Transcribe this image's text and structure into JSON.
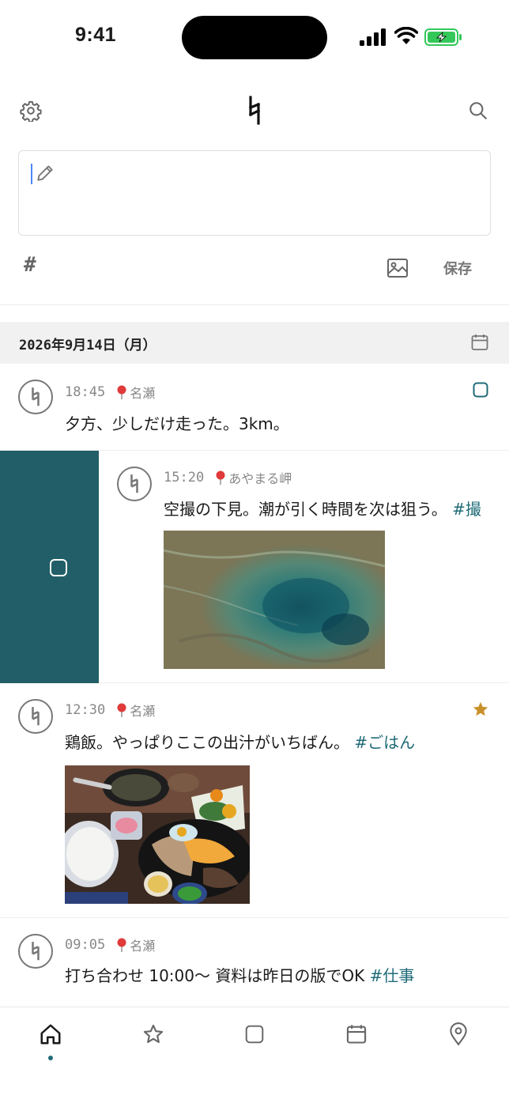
{
  "status_bar": {
    "time": "9:41"
  },
  "composer": {
    "value": "",
    "placeholder": "",
    "tag_label": "#",
    "save_label": "保存"
  },
  "date_header": {
    "label": "2026年9月14日（月）"
  },
  "entries": [
    {
      "time": "18:45",
      "location": "名瀬",
      "text": "夕方、少しだけ走った。3km。",
      "tag": "",
      "action": "square-icon"
    },
    {
      "time": "15:20",
      "location": "あやまる岬",
      "text": "空撮の下見。潮が引く時間を次は狙う。",
      "tag": "#撮",
      "image": "aerial-reef-photo"
    },
    {
      "time": "12:30",
      "location": "名瀬",
      "text": "鶏飯。やっぱりここの出汁がいちばん。",
      "tag": "#ごはん",
      "action": "star-icon",
      "image": "food-tray-photo"
    },
    {
      "time": "09:05",
      "location": "名瀬",
      "text": "打ち合わせ 10:00〜 資料は昨日の版でOK",
      "tag": "#仕事"
    }
  ],
  "tabs": [
    "home-icon",
    "star-icon",
    "square-icon",
    "calendar-icon",
    "location-icon"
  ],
  "colors": {
    "accent": "#1f6b78",
    "swipe_panel": "#215e68",
    "star": "#c8902a",
    "caret": "#4f86f7"
  }
}
